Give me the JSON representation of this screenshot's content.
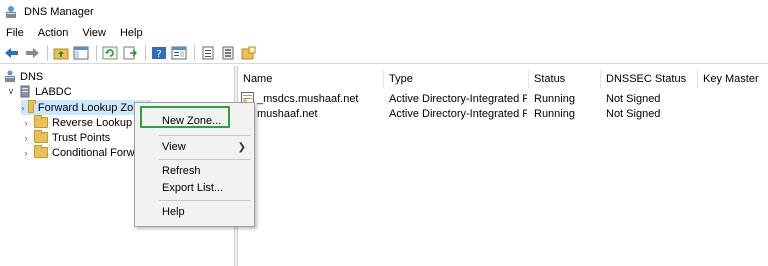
{
  "window": {
    "title": "DNS Manager"
  },
  "menu": [
    "File",
    "Action",
    "View",
    "Help"
  ],
  "toolbar": {
    "buttons": [
      "back-icon",
      "forward-icon",
      "up-folder-icon",
      "show-hide-tree-icon",
      "refresh-icon",
      "export-list-icon",
      "help-icon",
      "properties-icon",
      "list-icon",
      "details-icon",
      "new-icon"
    ]
  },
  "tree": {
    "root": "DNS",
    "server": "LABDC",
    "items": [
      "Forward Lookup Zones",
      "Reverse Lookup Zo",
      "Trust Points",
      "Conditional Forwar"
    ]
  },
  "list": {
    "columns": [
      "Name",
      "Type",
      "Status",
      "DNSSEC Status",
      "Key Master"
    ],
    "rows": [
      {
        "name": "_msdcs.mushaaf.net",
        "type": "Active Directory-Integrated Pr...",
        "status": "Running",
        "dnssec": "Not Signed",
        "key_master": ""
      },
      {
        "name": "mushaaf.net",
        "type": "Active Directory-Integrated Pr...",
        "status": "Running",
        "dnssec": "Not Signed",
        "key_master": ""
      }
    ]
  },
  "context_menu": {
    "items": [
      "New Zone...",
      "View",
      "Refresh",
      "Export List...",
      "Help"
    ],
    "highlight_color": "#2ea043"
  }
}
